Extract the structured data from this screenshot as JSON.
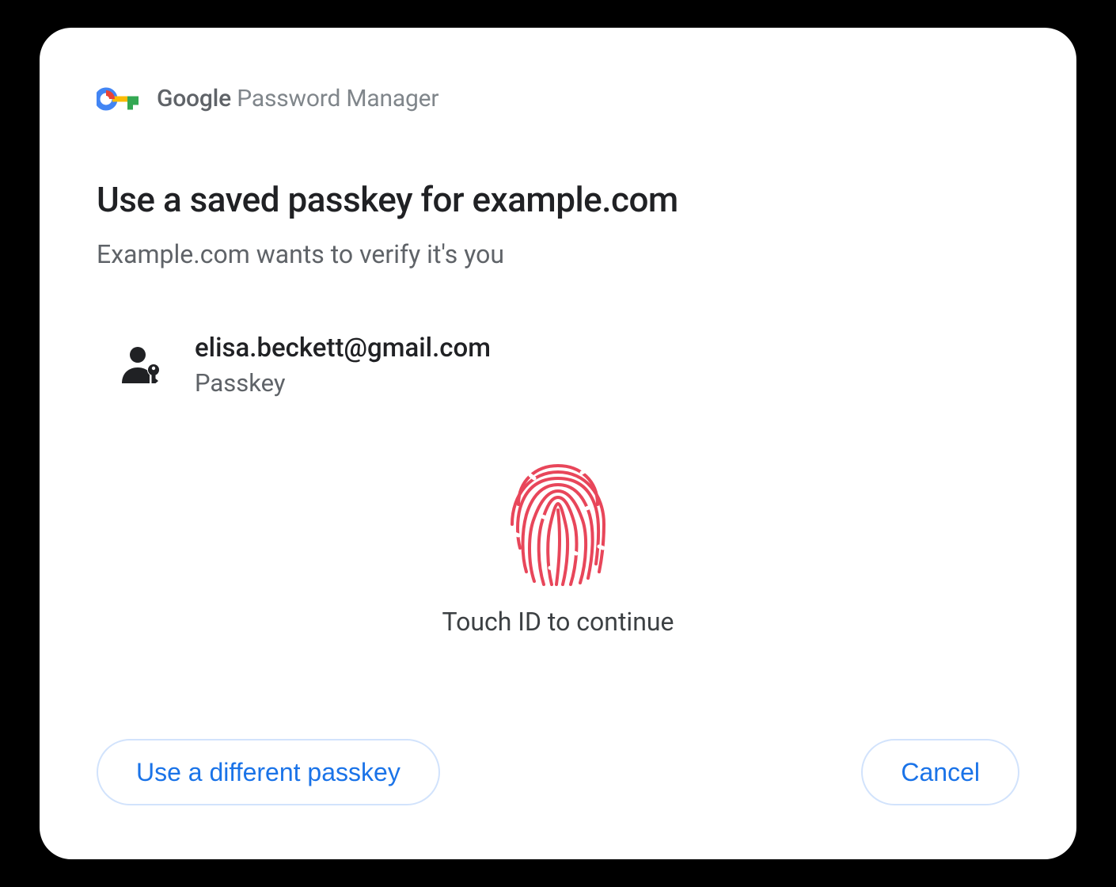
{
  "header": {
    "brand_google": "Google",
    "brand_pm": " Password Manager"
  },
  "dialog": {
    "title": "Use a saved passkey for example.com",
    "subtitle": "Example.com wants to verify it's you"
  },
  "account": {
    "email": "elisa.beckett@gmail.com",
    "type": "Passkey"
  },
  "touchid": {
    "prompt": "Touch ID to continue"
  },
  "buttons": {
    "different_passkey": "Use a different passkey",
    "cancel": "Cancel"
  }
}
